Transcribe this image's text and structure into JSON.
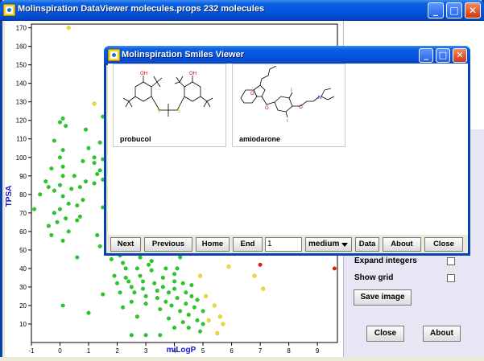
{
  "main_window": {
    "title": "Molinspiration DataViewer molecules.props 232 molecules",
    "minimize_glyph": "_",
    "maximize_glyph": "□",
    "close_glyph": "✕"
  },
  "chart_data": {
    "type": "scatter",
    "xlabel": "miLogP",
    "ylabel": "TPSA",
    "xlim": [
      -1,
      9.7
    ],
    "ylim": [
      0,
      172
    ],
    "x_ticks": [
      "-1",
      "0",
      "1",
      "2",
      "3",
      "4",
      "5",
      "6",
      "7",
      "8",
      "9"
    ],
    "y_ticks": [
      "10",
      "20",
      "30",
      "40",
      "50",
      "60",
      "70",
      "80",
      "90",
      "100",
      "110",
      "120",
      "130",
      "140",
      "150",
      "160",
      "170"
    ],
    "colors": {
      "green": "#22cc22",
      "yellow": "#eedd22",
      "red": "#dd2200"
    },
    "series": [
      {
        "color": "green",
        "points": [
          [
            -0.9,
            72
          ],
          [
            -0.7,
            80
          ],
          [
            -0.4,
            63
          ],
          [
            -0.2,
            70
          ],
          [
            -0.3,
            58
          ],
          [
            -0.5,
            87
          ],
          [
            -0.3,
            94
          ],
          [
            -0.4,
            84
          ],
          [
            -0.2,
            109
          ],
          [
            0.1,
            104
          ],
          [
            0.0,
            119
          ],
          [
            0.1,
            121
          ],
          [
            0.2,
            117
          ],
          [
            0.0,
            100
          ],
          [
            0.1,
            95
          ],
          [
            0.1,
            90
          ],
          [
            0.0,
            85
          ],
          [
            -0.2,
            82
          ],
          [
            0.1,
            79
          ],
          [
            0.3,
            75
          ],
          [
            0.0,
            72
          ],
          [
            0.2,
            67
          ],
          [
            0.3,
            60
          ],
          [
            -0.1,
            65
          ],
          [
            0.1,
            55
          ],
          [
            0.4,
            83
          ],
          [
            0.6,
            74
          ],
          [
            0.6,
            66
          ],
          [
            0.7,
            68
          ],
          [
            0.8,
            77
          ],
          [
            0.5,
            90
          ],
          [
            0.7,
            84
          ],
          [
            0.8,
            98
          ],
          [
            0.9,
            87
          ],
          [
            0.9,
            115
          ],
          [
            1.0,
            105
          ],
          [
            1.2,
            100
          ],
          [
            1.2,
            97
          ],
          [
            1.3,
            91
          ],
          [
            1.2,
            86
          ],
          [
            1.4,
            108
          ],
          [
            1.5,
            122
          ],
          [
            1.5,
            99
          ],
          [
            1.4,
            93
          ],
          [
            1.5,
            88
          ],
          [
            1.6,
            80
          ],
          [
            1.5,
            73
          ],
          [
            1.6,
            65
          ],
          [
            1.7,
            69
          ],
          [
            1.6,
            55
          ],
          [
            1.7,
            57
          ],
          [
            1.6,
            50
          ],
          [
            1.8,
            61
          ],
          [
            1.9,
            78
          ],
          [
            1.3,
            58
          ],
          [
            1.4,
            52
          ],
          [
            0.6,
            46
          ],
          [
            0.1,
            20
          ],
          [
            1.0,
            16
          ],
          [
            1.5,
            26
          ],
          [
            1.8,
            45
          ],
          [
            2.0,
            32
          ],
          [
            2.1,
            47
          ],
          [
            2.2,
            43
          ],
          [
            2.3,
            40
          ],
          [
            2.3,
            35
          ],
          [
            2.4,
            33
          ],
          [
            2.5,
            30
          ],
          [
            2.6,
            27
          ],
          [
            2.5,
            22
          ],
          [
            2.7,
            40
          ],
          [
            2.8,
            36
          ],
          [
            2.9,
            33
          ],
          [
            2.9,
            29
          ],
          [
            3.0,
            25
          ],
          [
            3.0,
            21
          ],
          [
            3.1,
            42
          ],
          [
            3.2,
            44
          ],
          [
            3.2,
            39
          ],
          [
            3.3,
            32
          ],
          [
            3.4,
            28
          ],
          [
            3.4,
            24
          ],
          [
            3.5,
            18
          ],
          [
            3.6,
            35
          ],
          [
            3.6,
            30
          ],
          [
            3.7,
            40
          ],
          [
            3.7,
            22
          ],
          [
            3.8,
            27
          ],
          [
            3.8,
            13
          ],
          [
            3.9,
            20
          ],
          [
            4.0,
            33
          ],
          [
            4.0,
            29
          ],
          [
            4.0,
            37
          ],
          [
            4.1,
            40
          ],
          [
            4.1,
            24
          ],
          [
            4.2,
            17
          ],
          [
            4.3,
            32
          ],
          [
            4.3,
            11
          ],
          [
            4.4,
            27
          ],
          [
            4.4,
            21
          ],
          [
            4.5,
            8
          ],
          [
            4.5,
            15
          ],
          [
            4.6,
            25
          ],
          [
            4.6,
            31
          ],
          [
            4.7,
            19
          ],
          [
            4.8,
            12
          ],
          [
            4.8,
            23
          ],
          [
            4.9,
            6
          ],
          [
            5.0,
            17
          ],
          [
            5.0,
            10
          ],
          [
            3.0,
            4
          ],
          [
            3.5,
            4
          ],
          [
            2.5,
            4
          ],
          [
            4.0,
            8
          ],
          [
            2.7,
            14
          ],
          [
            2.2,
            19
          ],
          [
            1.9,
            36
          ],
          [
            2.8,
            46
          ],
          [
            2.1,
            27
          ],
          [
            3.3,
            48
          ],
          [
            4.2,
            46
          ]
        ]
      },
      {
        "color": "yellow",
        "points": [
          [
            0.3,
            170
          ],
          [
            1.2,
            129
          ],
          [
            5.1,
            25
          ],
          [
            5.4,
            20
          ],
          [
            5.6,
            14
          ],
          [
            5.7,
            10
          ],
          [
            5.5,
            5
          ],
          [
            5.9,
            41
          ],
          [
            6.8,
            36
          ],
          [
            7.1,
            29
          ],
          [
            4.9,
            36
          ],
          [
            5.2,
            12
          ]
        ]
      },
      {
        "color": "red",
        "points": [
          [
            7.0,
            42
          ],
          [
            9.6,
            40
          ]
        ]
      }
    ]
  },
  "options": {
    "expand_integers_label": "Expand integers",
    "show_grid_label": "Show grid",
    "save_image_label": "Save image",
    "close_label": "Close",
    "about_label": "About"
  },
  "smiles_viewer": {
    "title": "Molinspiration Smiles Viewer",
    "molecules": [
      {
        "name": "probucol"
      },
      {
        "name": "amiodarone"
      }
    ],
    "atom_labels": {
      "oh": "OH",
      "s": "S",
      "o": "O",
      "i": "I",
      "n": "N"
    },
    "toolbar": {
      "next": "Next",
      "previous": "Previous",
      "home": "Home",
      "end": "End",
      "page_value": "1",
      "size_selected": "medium",
      "data": "Data",
      "about": "About",
      "close": "Close"
    }
  }
}
